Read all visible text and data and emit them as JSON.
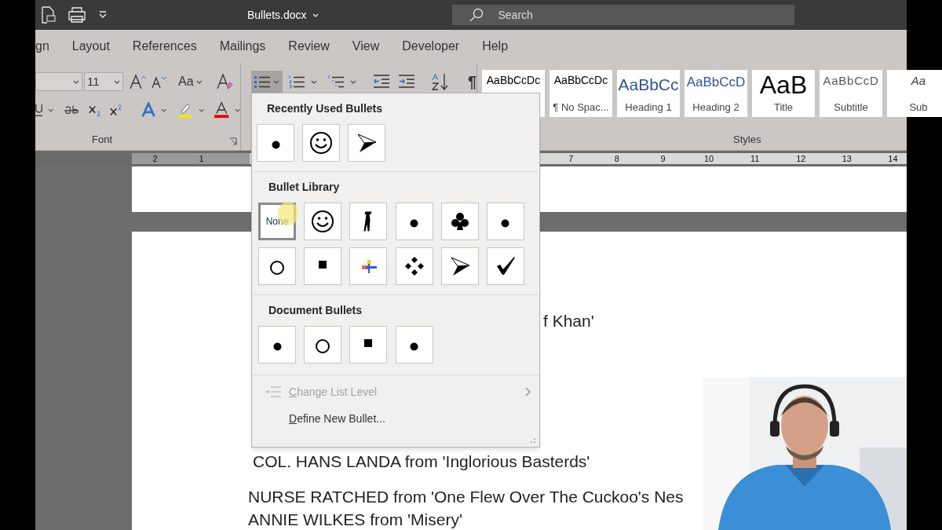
{
  "title_bar": {
    "title": "Bullets.docx",
    "search": {
      "placeholder": "Search"
    }
  },
  "tabs": [
    {
      "label": "gn",
      "selected": false
    },
    {
      "label": "Layout",
      "selected": false
    },
    {
      "label": "References",
      "selected": false
    },
    {
      "label": "Mailings",
      "selected": false
    },
    {
      "label": "Review",
      "selected": false
    },
    {
      "label": "View",
      "selected": false
    },
    {
      "label": "Developer",
      "selected": false
    },
    {
      "label": "Help",
      "selected": false
    }
  ],
  "font_group": {
    "label": "Font",
    "font_size": "11",
    "change_case": "Aa"
  },
  "paragraph_group": {
    "bullets_pressed": true,
    "pilcrow": "¶"
  },
  "styles_group": {
    "label": "Styles",
    "items": [
      {
        "preview": "AaBbCcDc",
        "kind": "normal"
      },
      {
        "preview": "AaBbCcDc",
        "name": "¶ No Spac...",
        "kind": "normal"
      },
      {
        "preview": "AaBbCc",
        "name": "Heading 1",
        "kind": "heading1"
      },
      {
        "preview": "AaBbCcD",
        "name": "Heading 2",
        "kind": "heading2"
      },
      {
        "preview": "AaB",
        "name": "Title",
        "kind": "title"
      },
      {
        "preview": "AaBbCcD",
        "name": "Subtitle",
        "kind": "subtitle"
      },
      {
        "preview": "Aa",
        "name": "Sub",
        "kind": "emphasis"
      }
    ]
  },
  "ruler": {
    "left_numbers": [
      "2",
      "1"
    ],
    "right_numbers": [
      "7",
      "8",
      "9",
      "10",
      "11",
      "12",
      "13",
      "14"
    ]
  },
  "bullets_menu": {
    "sections": [
      {
        "title": "Recently Used Bullets",
        "items": [
          {
            "kind": "dot",
            "selected": false
          },
          {
            "kind": "smiley",
            "selected": false
          },
          {
            "kind": "arrow",
            "selected": false
          }
        ]
      },
      {
        "title": "Bullet Library",
        "items": [
          {
            "kind": "none",
            "label": "None",
            "selected": true
          },
          {
            "kind": "smiley",
            "selected": false
          },
          {
            "kind": "figure",
            "selected": false
          },
          {
            "kind": "dot",
            "selected": false
          },
          {
            "kind": "club",
            "selected": false
          },
          {
            "kind": "dot",
            "selected": false
          },
          {
            "kind": "circle",
            "selected": false
          },
          {
            "kind": "square",
            "selected": false
          },
          {
            "kind": "picture",
            "selected": false
          },
          {
            "kind": "diamonds",
            "selected": false
          },
          {
            "kind": "arrow",
            "selected": false
          },
          {
            "kind": "check",
            "selected": false
          }
        ]
      },
      {
        "title": "Document Bullets",
        "items": [
          {
            "kind": "dot",
            "selected": false
          },
          {
            "kind": "circle",
            "selected": false
          },
          {
            "kind": "square",
            "selected": false
          },
          {
            "kind": "dot",
            "selected": false
          }
        ]
      }
    ],
    "commands": [
      {
        "label": "Change List Level",
        "disabled": true,
        "submenu": true
      },
      {
        "label": "Define New Bullet...",
        "disabled": false,
        "submenu": false
      }
    ]
  },
  "document": {
    "lines": [
      "f Khan'",
      "COL. HANS LANDA from 'Inglorious Basterds'",
      "NURSE RATCHED from 'One Flew Over The Cuckoo's Nes",
      "ANNIE WILKES from 'Misery'"
    ]
  },
  "webcam": {
    "kind": "picture"
  }
}
